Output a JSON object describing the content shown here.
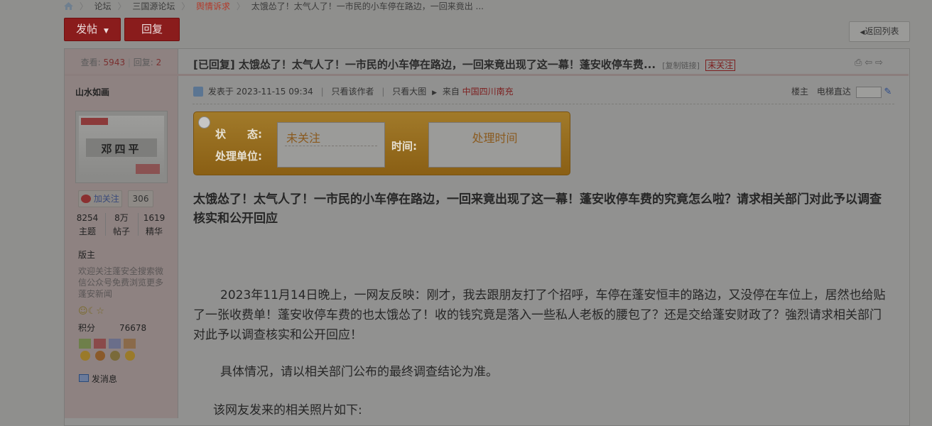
{
  "breadcrumb": {
    "items": [
      "论坛",
      "三国源论坛",
      "舆情诉求",
      "太饿怂了！太气人了！一市民的小车停在路边，一回来竟出 ..."
    ]
  },
  "toolbar": {
    "post_label": "发帖",
    "reply_label": "回复",
    "back_label": "返回列表"
  },
  "thread_stats": {
    "views_label": "查看:",
    "views": "5943",
    "replies_label": "回复:",
    "replies": "2"
  },
  "post": {
    "title": "[已回复] 太饿怂了！太气人了！一市民的小车停在路边，一回来竟出现了这一幕！蓬安收停车费...",
    "copy_link": "[复制链接]",
    "follow_badge": "未关注",
    "meta": {
      "posted_label": "发表于",
      "posted_at": "2023-11-15 09:34",
      "author_only": "只看该作者",
      "big_image": "只看大图",
      "from_label": "来自",
      "location": "中国四川南充",
      "floor": "楼主",
      "elevator": "电梯直达"
    },
    "status_box": {
      "status_label": "状　　态:",
      "unit_label": "处理单位:",
      "status_value": "未关注",
      "time_label": "时间:",
      "time_value": "处理时间"
    },
    "headline": "太饿怂了！太气人了！一市民的小车停在路边，一回来竟出现了这一幕！蓬安收停车费的究竟怎么啦？请求相关部门对此予以调查核实和公开回应",
    "paragraph1": "2023年11月14日晚上，一网友反映：刚才，我去跟朋友打了个招呼，车停在蓬安恒丰的路边，又没停在车位上，居然也给贴了一张收费单！蓬安收停车费的也太饿怂了！收的钱究竟是落入一些私人老板的腰包了？还是交给蓬安财政了？強烈请求相关部门对此予以调查核实和公开回应！",
    "paragraph2": "具体情况，请以相关部门公布的最终调查结论为准。",
    "paragraph3": "该网友发来的相关照片如下:"
  },
  "author": {
    "name": "山水如画",
    "avatar_text": "邓四平",
    "follow_label": "加关注",
    "followers": "306",
    "stats": [
      {
        "value": "8254",
        "label": "主题"
      },
      {
        "value": "8万",
        "label": "帖子"
      },
      {
        "value": "1619",
        "label": "精华"
      }
    ],
    "role": "版主",
    "signature": "欢迎关注蓬安全搜索微信公众号免费浏览更多蓬安新闻",
    "points_label": "积分",
    "points": "76678",
    "message_label": "发消息"
  },
  "colors": {
    "accent_red": "#8a1c1c",
    "status_gold": "#a17a2a",
    "link_red": "#7d1f1f"
  },
  "icons": [
    "home-icon",
    "user-post-icon",
    "printer-icon",
    "prev-arrow-icon",
    "next-arrow-icon",
    "jump-pen-icon",
    "weibo-icon",
    "mail-icon",
    "medal-icon"
  ]
}
